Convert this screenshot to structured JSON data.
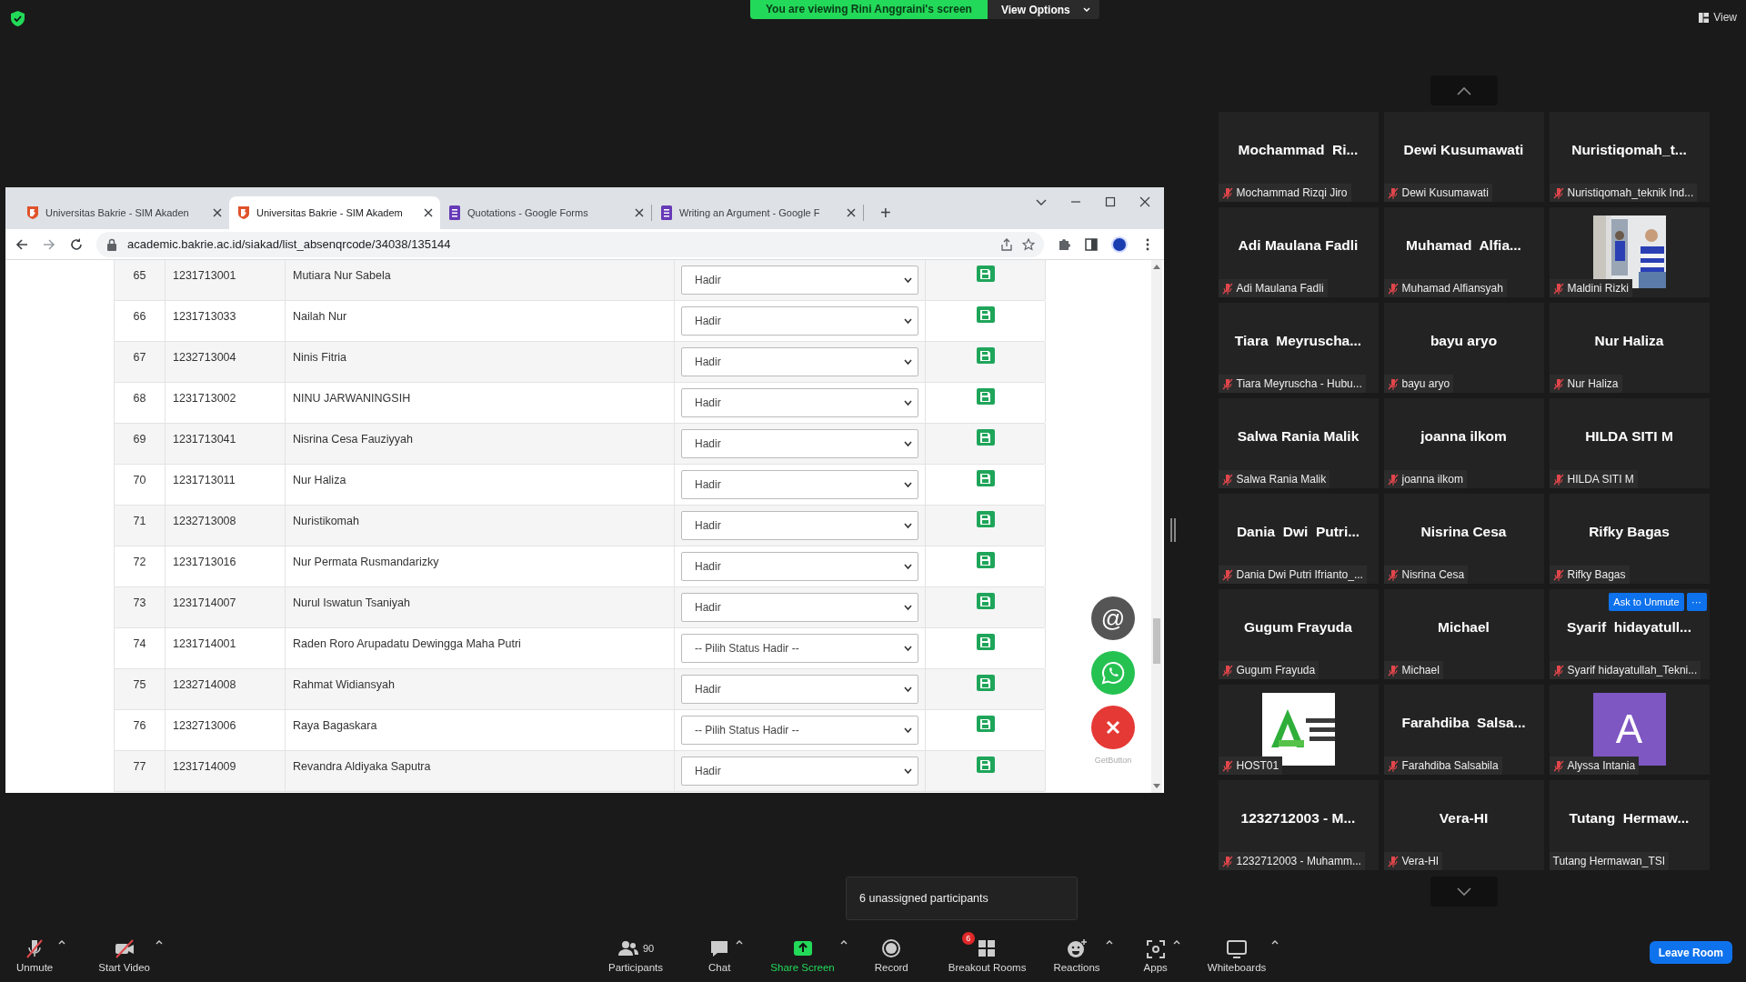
{
  "meeting_bar": {
    "viewing_banner": "You are viewing Rini Anggraini's screen",
    "view_options": "View Options",
    "view_button": "View"
  },
  "browser": {
    "tabs": [
      {
        "title": "Universitas Bakrie - SIM Akaden",
        "kind": "site",
        "selected": false
      },
      {
        "title": "Universitas Bakrie - SIM Akadem",
        "kind": "site",
        "selected": true
      },
      {
        "title": "Quotations - Google Forms",
        "kind": "form",
        "selected": false
      },
      {
        "title": "Writing an Argument - Google F",
        "kind": "form",
        "selected": false
      }
    ],
    "new_tab": "+",
    "address": "academic.bakrie.ac.id/siakad/list_absenqrcode/34038/135144",
    "table": {
      "rows": [
        {
          "no": "65",
          "nim": "1231713001",
          "name": "Mutiara Nur Sabela",
          "status": "Hadir"
        },
        {
          "no": "66",
          "nim": "1231713033",
          "name": "Nailah Nur",
          "status": "Hadir"
        },
        {
          "no": "67",
          "nim": "1232713004",
          "name": "Ninis Fitria",
          "status": "Hadir"
        },
        {
          "no": "68",
          "nim": "1231713002",
          "name": "NINU JARWANINGSIH",
          "status": "Hadir"
        },
        {
          "no": "69",
          "nim": "1231713041",
          "name": "Nisrina Cesa Fauziyyah",
          "status": "Hadir"
        },
        {
          "no": "70",
          "nim": "1231713011",
          "name": "Nur Haliza",
          "status": "Hadir"
        },
        {
          "no": "71",
          "nim": "1232713008",
          "name": "Nuristikomah",
          "status": "Hadir"
        },
        {
          "no": "72",
          "nim": "1231713016",
          "name": "Nur Permata Rusmandarizky",
          "status": "Hadir"
        },
        {
          "no": "73",
          "nim": "1231714007",
          "name": "Nurul Iswatun Tsaniyah",
          "status": "Hadir"
        },
        {
          "no": "74",
          "nim": "1231714001",
          "name": "Raden Roro Arupadatu Dewingga Maha Putri",
          "status": "-- Pilih Status Hadir --"
        },
        {
          "no": "75",
          "nim": "1232714008",
          "name": "Rahmat Widiansyah",
          "status": "Hadir"
        },
        {
          "no": "76",
          "nim": "1232713006",
          "name": "Raya Bagaskara",
          "status": "-- Pilih Status Hadir --"
        },
        {
          "no": "77",
          "nim": "1231714009",
          "name": "Revandra Aldiyaka Saputra",
          "status": "Hadir"
        }
      ]
    },
    "floating_buttons": [
      {
        "kind": "email",
        "label": "@"
      },
      {
        "kind": "whatsapp"
      },
      {
        "kind": "close"
      }
    ],
    "widget_credit": "GetButton"
  },
  "participants": {
    "tiles": [
      {
        "display": "Mochammad  Ri...",
        "label": "Mochammad Rizqi Jiro",
        "muted": true,
        "kind": "name"
      },
      {
        "display": "Dewi Kusumawati",
        "label": "Dewi Kusumawati",
        "muted": true,
        "kind": "name"
      },
      {
        "display": "Nuristiqomah_t...",
        "label": "Nuristiqomah_teknik Ind...",
        "muted": true,
        "kind": "name"
      },
      {
        "display": "Adi Maulana Fadli",
        "label": "Adi Maulana Fadli",
        "muted": true,
        "kind": "name"
      },
      {
        "display": "Muhamad  Alfia...",
        "label": "Muhamad Alfiansyah",
        "muted": true,
        "kind": "name"
      },
      {
        "label": "Maldini Rizki",
        "muted": true,
        "kind": "picture"
      },
      {
        "display": "Tiara  Meyruscha...",
        "label": "Tiara Meyruscha - Hubu...",
        "muted": true,
        "kind": "name"
      },
      {
        "display": "bayu aryo",
        "label": "bayu aryo",
        "muted": true,
        "kind": "name"
      },
      {
        "display": "Nur Haliza",
        "label": "Nur Haliza",
        "muted": true,
        "kind": "name"
      },
      {
        "display": "Salwa Rania Malik",
        "label": "Salwa Rania Malik",
        "muted": true,
        "kind": "name"
      },
      {
        "display": "joanna ilkom",
        "label": "joanna ilkom",
        "muted": true,
        "kind": "name"
      },
      {
        "display": "HILDA SITI M",
        "label": "HILDA SITI M",
        "muted": true,
        "kind": "name"
      },
      {
        "display": "Dania  Dwi  Putri...",
        "label": "Dania Dwi Putri Ifrianto_...",
        "muted": true,
        "kind": "name"
      },
      {
        "display": "Nisrina Cesa",
        "label": "Nisrina Cesa",
        "muted": true,
        "kind": "name"
      },
      {
        "display": "Rifky Bagas",
        "label": "Rifky Bagas",
        "muted": true,
        "kind": "name"
      },
      {
        "display": "Gugum Frayuda",
        "label": "Gugum Frayuda",
        "muted": true,
        "kind": "name"
      },
      {
        "display": "Michael",
        "label": "Michael",
        "muted": true,
        "kind": "name"
      },
      {
        "display": "Syarif  hidayatull...",
        "label": "Syarif hidayatullah_Tekni...",
        "muted": true,
        "kind": "name",
        "action": "Ask to Unmute",
        "more": "···"
      },
      {
        "label": "HOST01",
        "muted": true,
        "kind": "logo"
      },
      {
        "display": "Farahdiba  Salsa...",
        "label": "Farahdiba Salsabila",
        "muted": true,
        "kind": "name"
      },
      {
        "label": "Alyssa Intania",
        "muted": true,
        "kind": "avatar",
        "initial": "A"
      },
      {
        "display": "1232712003 - M...",
        "label": "1232712003 - Muhamm...",
        "muted": true,
        "kind": "name"
      },
      {
        "display": "Vera-HI",
        "label": "Vera-HI",
        "muted": true,
        "kind": "name"
      },
      {
        "display": "Tutang  Hermaw...",
        "label": "Tutang Hermawan_TSI",
        "muted": false,
        "kind": "name"
      }
    ]
  },
  "breakout_popup": "6 unassigned participants",
  "toolbar": {
    "left": [
      {
        "label": "Unmute",
        "kind": "mic_off",
        "caret": true
      },
      {
        "label": "Start Video",
        "kind": "video_off",
        "caret": true
      }
    ],
    "center": [
      {
        "label": "Participants",
        "kind": "participants",
        "count": "90",
        "caret": false
      },
      {
        "label": "Chat",
        "kind": "chat",
        "caret": true
      },
      {
        "label": "Share Screen",
        "kind": "share",
        "caret": true
      },
      {
        "label": "Record",
        "kind": "record",
        "caret": false
      },
      {
        "label": "Breakout Rooms",
        "kind": "breakout",
        "badge": "6",
        "caret": false
      },
      {
        "label": "Reactions",
        "kind": "reactions",
        "caret": true
      },
      {
        "label": "Apps",
        "kind": "apps",
        "caret": true
      },
      {
        "label": "Whiteboards",
        "kind": "whiteboard",
        "caret": true
      }
    ],
    "leave": "Leave Room"
  }
}
